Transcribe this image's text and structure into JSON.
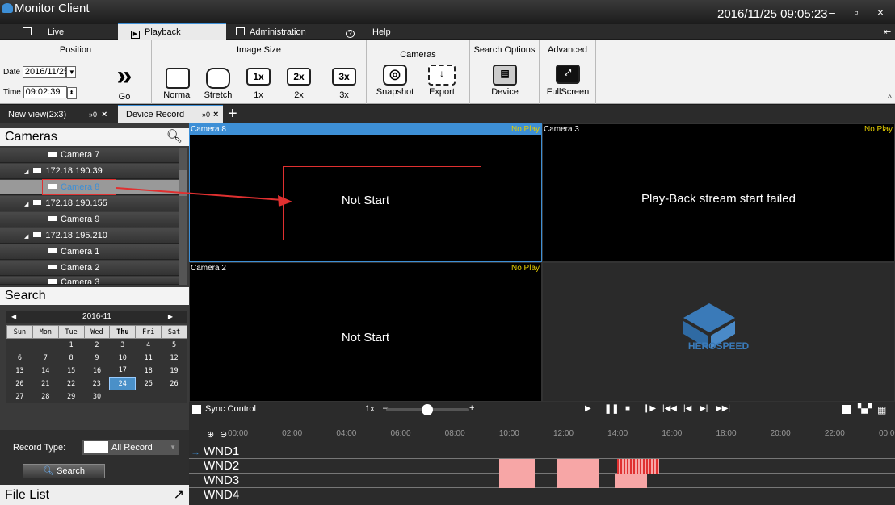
{
  "window": {
    "title": "Monitor Client",
    "datetime": "2016/11/25 09:05:23"
  },
  "main_tabs": [
    "Live",
    "Playback",
    "Administration",
    "Help"
  ],
  "ribbon": {
    "position_label": "Position",
    "date_label": "Date",
    "date_value": "2016/11/25",
    "time_label": "Time",
    "time_value": "09:02:39",
    "go": "Go",
    "image_size_label": "Image Size",
    "normal": "Normal",
    "stretch": "Stretch",
    "x1": "1x",
    "x2": "2x",
    "x3": "3x",
    "x1_ico": "1x",
    "x2_ico": "2x",
    "x3_ico": "3x",
    "cameras_label": "Cameras",
    "snapshot": "Snapshot",
    "export": "Export",
    "search_options_label": "Search Options",
    "device": "Device",
    "advanced_label": "Advanced",
    "fullscreen": "FullScreen"
  },
  "view_tabs": [
    {
      "label": "New view(2x3)",
      "badge": "»0"
    },
    {
      "label": "Device Record",
      "badge": "»0"
    }
  ],
  "left": {
    "cameras_title": "Cameras",
    "tree": [
      "Camera 7",
      "172.18.190.39",
      "Camera 8",
      "172.18.190.155",
      "Camera 9",
      "172.18.195.210",
      "Camera 1",
      "Camera 2",
      "Camera 3"
    ],
    "search_title": "Search",
    "cal_month": "2016-11",
    "cal_days": [
      "Sun",
      "Mon",
      "Tue",
      "Wed",
      "Thu",
      "Fri",
      "Sat"
    ],
    "cal_weeks": [
      [
        "",
        "",
        "1",
        "2",
        "3",
        "4",
        "5"
      ],
      [
        "6",
        "7",
        "8",
        "9",
        "10",
        "11",
        "12"
      ],
      [
        "13",
        "14",
        "15",
        "16",
        "17",
        "18",
        "19"
      ],
      [
        "20",
        "21",
        "22",
        "23",
        "24",
        "25",
        "26"
      ],
      [
        "27",
        "28",
        "29",
        "30",
        "",
        "",
        ""
      ]
    ],
    "cal_selected": "24",
    "record_type_label": "Record Type:",
    "record_type_value": "All Record",
    "search_button": "Search",
    "file_list": "File List"
  },
  "panes": [
    {
      "name": "Camera 8",
      "status": "No Play",
      "message": "Not Start"
    },
    {
      "name": "Camera 3",
      "status": "No Play",
      "message": "Play-Back stream start failed"
    },
    {
      "name": "Camera 2",
      "status": "No Play",
      "message": "Not Start"
    },
    {
      "name": "",
      "status": "",
      "message": "HEROSPEED"
    }
  ],
  "controls": {
    "sync": "Sync Control",
    "speed": "1x",
    "speed_fraction": 0.5
  },
  "timeline": {
    "ticks": [
      "00:00",
      "02:00",
      "04:00",
      "06:00",
      "08:00",
      "10:00",
      "12:00",
      "14:00",
      "16:00",
      "18:00",
      "20:00",
      "22:00",
      "00:00"
    ],
    "windows": [
      "WND1",
      "WND2",
      "WND3",
      "WND4"
    ]
  },
  "colors": {
    "accent": "#3d8fd6",
    "record": "#f7a6a6",
    "no_play": "#e8d000",
    "annotation": "#e03030"
  }
}
